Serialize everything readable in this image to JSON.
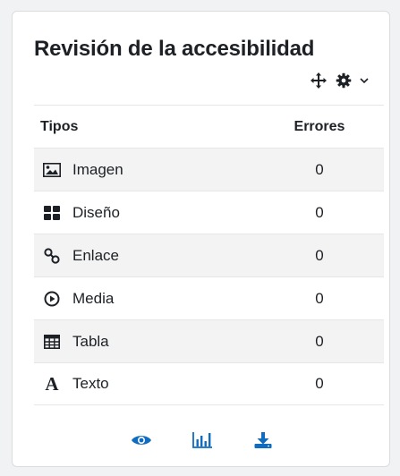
{
  "block": {
    "title": "Revisión de la accesibilidad"
  },
  "table": {
    "col_types": "Tipos",
    "col_errors": "Errores",
    "rows": [
      {
        "label": "Imagen",
        "errors": "0",
        "icon": "image-icon"
      },
      {
        "label": "Diseño",
        "errors": "0",
        "icon": "layout-icon"
      },
      {
        "label": "Enlace",
        "errors": "0",
        "icon": "link-icon"
      },
      {
        "label": "Media",
        "errors": "0",
        "icon": "media-icon"
      },
      {
        "label": "Tabla",
        "errors": "0",
        "icon": "table-icon"
      },
      {
        "label": "Texto",
        "errors": "0",
        "icon": "text-icon"
      }
    ]
  },
  "colors": {
    "accent": "#0f6cbf",
    "text": "#1d2125",
    "stripe": "#f3f3f4"
  },
  "footer": {
    "icons": [
      "eye-icon",
      "bar-chart-icon",
      "download-icon"
    ]
  }
}
